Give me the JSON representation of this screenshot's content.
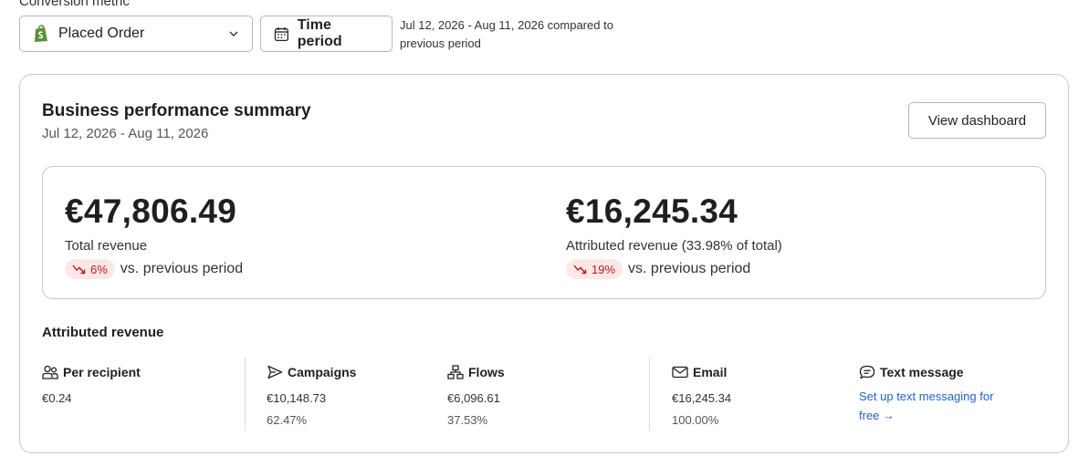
{
  "filters": {
    "metric_label": "Conversion metric",
    "metric_value": "Placed Order",
    "time_button": "Time period",
    "period_note": "Jul 12, 2026 - Aug 11, 2026 compared to previous period"
  },
  "summary": {
    "title": "Business performance summary",
    "range": "Jul 12, 2026 - Aug 11, 2026",
    "view_button": "View dashboard",
    "kpis": [
      {
        "value": "€47,806.49",
        "label": "Total revenue",
        "change": "6%",
        "change_direction": "down",
        "compare": "vs. previous period"
      },
      {
        "value": "€16,245.34",
        "label": "Attributed revenue (33.98% of total)",
        "change": "19%",
        "change_direction": "down",
        "compare": "vs. previous period"
      }
    ]
  },
  "attributed": {
    "title": "Attributed revenue",
    "columns": [
      {
        "icon": "people-icon",
        "label": "Per recipient",
        "value": "€0.24"
      },
      {
        "icon": "send-icon",
        "label": "Campaigns",
        "value": "€10,148.73",
        "percent": "62.47%"
      },
      {
        "icon": "flow-icon",
        "label": "Flows",
        "value": "€6,096.61",
        "percent": "37.53%"
      },
      {
        "icon": "mail-icon",
        "label": "Email",
        "value": "€16,245.34",
        "percent": "100.00%"
      },
      {
        "icon": "chat-icon",
        "label": "Text message",
        "link": "Set up text messaging for free →"
      }
    ]
  },
  "colors": {
    "decline_text": "#c4161c",
    "decline_bg": "#fde8e8",
    "link": "#2463c9",
    "shopify_green": "#5e8e3e"
  }
}
